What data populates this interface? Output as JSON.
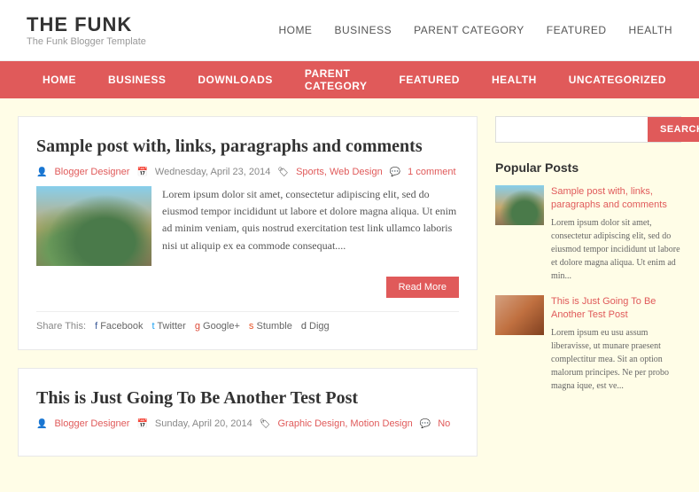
{
  "site": {
    "title": "THE FUNK",
    "subtitle": "The Funk Blogger Template"
  },
  "top_nav": {
    "items": [
      {
        "label": "HOME"
      },
      {
        "label": "BUSINESS"
      },
      {
        "label": "PARENT CATEGORY"
      },
      {
        "label": "FEATURED"
      },
      {
        "label": "HEALTH"
      }
    ]
  },
  "category_nav": {
    "items": [
      {
        "label": "HOME"
      },
      {
        "label": "BUSINESS"
      },
      {
        "label": "DOWNLOADS"
      },
      {
        "label": "PARENT CATEGORY"
      },
      {
        "label": "FEATURED"
      },
      {
        "label": "HEALTH"
      },
      {
        "label": "UNCATEGORIZED"
      }
    ]
  },
  "posts": [
    {
      "title": "Sample post with, links, paragraphs and comments",
      "author": "Blogger Designer",
      "date": "Wednesday, April 23, 2014",
      "categories": "Sports, Web Design",
      "comments": "1 comment",
      "excerpt": "Lorem ipsum dolor sit amet, consectetur adipiscing elit, sed do eiusmod tempor incididunt ut labore et dolore magna aliqua. Ut enim ad minim veniam, quis nostrud exercitation test link ullamco laboris nisi ut aliquip ex ea commode consequat....",
      "read_more": "Read More",
      "share_label": "Share This:",
      "share_items": [
        {
          "icon": "f",
          "label": "Facebook"
        },
        {
          "icon": "t",
          "label": "Twitter"
        },
        {
          "icon": "g",
          "label": "Google+"
        },
        {
          "icon": "s",
          "label": "Stumble"
        },
        {
          "icon": "d",
          "label": "Digg"
        }
      ]
    },
    {
      "title": "This is Just Going To Be Another Test Post",
      "author": "Blogger Designer",
      "date": "Sunday, April 20, 2014",
      "categories": "Graphic Design, Motion Design",
      "comments": "No"
    }
  ],
  "search": {
    "placeholder": "",
    "button_label": "SEARCH"
  },
  "sidebar": {
    "popular_posts_title": "Popular Posts",
    "popular_posts": [
      {
        "title": "Sample post with, links, paragraphs and comments",
        "excerpt": "Lorem ipsum dolor sit amet, consectetur adipiscing elit, sed do eiusmod tempor incididunt ut labore et dolore magna aliqua. Ut enim ad min..."
      },
      {
        "title": "This is Just Going To Be Another Test Post",
        "excerpt": "Lorem ipsum eu usu assum liberavisse, ut munare praesent complectitur mea. Sit an option malorum principes. Ne per probo magna ique, est ve..."
      }
    ]
  }
}
